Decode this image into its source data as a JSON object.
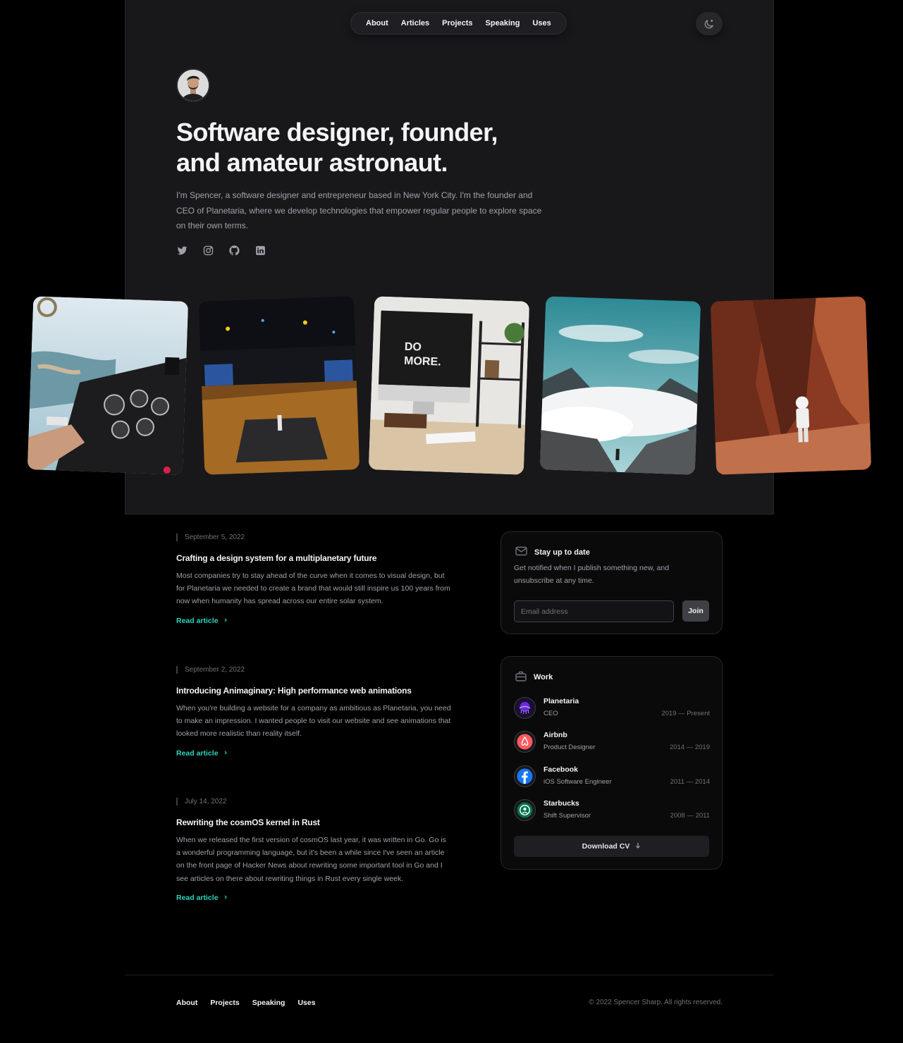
{
  "nav": {
    "items": [
      "About",
      "Articles",
      "Projects",
      "Speaking",
      "Uses"
    ],
    "theme_toggle_icon": "moon-sparkle-icon"
  },
  "hero": {
    "avatar_icon": "profile-photo",
    "title": "Software designer, founder, and amateur astronaut.",
    "description": "I'm Spencer, a software designer and entrepreneur based in New York City. I'm the founder and CEO of Planetaria, where we develop technologies that empower regular people to explore space on their own terms.",
    "socials": [
      "twitter-icon",
      "instagram-icon",
      "github-icon",
      "linkedin-icon"
    ]
  },
  "photos": [
    "cockpit-photo",
    "conference-stage-photo",
    "desk-imac-photo",
    "mountain-clouds-photo",
    "astronaut-canyon-photo"
  ],
  "articles": [
    {
      "date": "September 5, 2022",
      "title": "Crafting a design system for a multiplanetary future",
      "description": "Most companies try to stay ahead of the curve when it comes to visual design, but for Planetaria we needed to create a brand that would still inspire us 100 years from now when humanity has spread across our entire solar system.",
      "link": "Read article"
    },
    {
      "date": "September 2, 2022",
      "title": "Introducing Animaginary: High performance web animations",
      "description": "When you're building a website for a company as ambitious as Planetaria, you need to make an impression. I wanted people to visit our website and see animations that looked more realistic than reality itself.",
      "link": "Read article"
    },
    {
      "date": "July 14, 2022",
      "title": "Rewriting the cosmOS kernel in Rust",
      "description": "When we released the first version of cosmOS last year, it was written in Go. Go is a wonderful programming language, but it's been a while since I've seen an article on the front page of Hacker News about rewriting some important tool in Go and I see articles on there about rewriting things in Rust every single week.",
      "link": "Read article"
    }
  ],
  "newsletter": {
    "title": "Stay up to date",
    "description": "Get notified when I publish something new, and unsubscribe at any time.",
    "placeholder": "Email address",
    "button": "Join"
  },
  "work": {
    "title": "Work",
    "jobs": [
      {
        "company": "Planetaria",
        "role": "CEO",
        "dates": "2019 — Present",
        "logo": "planetaria-logo-icon"
      },
      {
        "company": "Airbnb",
        "role": "Product Designer",
        "dates": "2014 — 2019",
        "logo": "airbnb-logo-icon"
      },
      {
        "company": "Facebook",
        "role": "iOS Software Engineer",
        "dates": "2011 — 2014",
        "logo": "facebook-logo-icon"
      },
      {
        "company": "Starbucks",
        "role": "Shift Supervisor",
        "dates": "2008 — 2011",
        "logo": "starbucks-logo-icon"
      }
    ],
    "download": "Download CV"
  },
  "footer": {
    "links": [
      "About",
      "Projects",
      "Speaking",
      "Uses"
    ],
    "copyright": "© 2022 Spencer Sharp. All rights reserved."
  },
  "colors": {
    "accent": "#2dd4bf",
    "page_bg": "#000000",
    "frame_bg": "#18181b"
  }
}
